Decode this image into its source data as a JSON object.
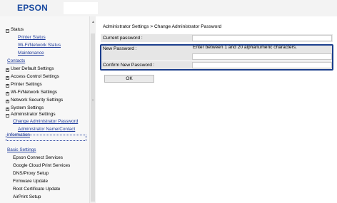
{
  "header": {
    "logo": "EPSON"
  },
  "sidebar": {
    "items": [
      {
        "label": "Status",
        "box": "−"
      },
      {
        "label": "Printer Status"
      },
      {
        "label": "Wi-Fi/Network Status"
      },
      {
        "label": "Maintenance"
      },
      {
        "label": "Contacts"
      },
      {
        "label": "User Default Settings",
        "box": "+"
      },
      {
        "label": "Access Control Settings",
        "box": "+"
      },
      {
        "label": "Printer Settings",
        "box": "+"
      },
      {
        "label": "Wi-Fi/Network Settings",
        "box": "+"
      },
      {
        "label": "Network Security Settings",
        "box": "+"
      },
      {
        "label": "System Settings",
        "box": "+"
      },
      {
        "label": "Administrator Settings",
        "box": "−"
      },
      {
        "label": "Change Administrator Password"
      },
      {
        "label": "Administrator Name/Contact"
      },
      {
        "label": "Information"
      },
      {
        "label": "Basic Settings"
      },
      {
        "label": "Epson Connect Services"
      },
      {
        "label": "Google Cloud Print Services"
      },
      {
        "label": "DNS/Proxy Setup"
      },
      {
        "label": "Firmware Update"
      },
      {
        "label": "Root Certificate Update"
      },
      {
        "label": "AirPrint Setup"
      }
    ]
  },
  "main": {
    "breadcrumb": "Administrator Settings > Change Administrator Password",
    "current_password_label": "Current password :",
    "new_password_label": "New Password :",
    "new_password_hint": "Enter between 1 and 20 alphanumeric characters.",
    "confirm_password_label": "Confirm New Password :",
    "ok_label": "OK"
  }
}
